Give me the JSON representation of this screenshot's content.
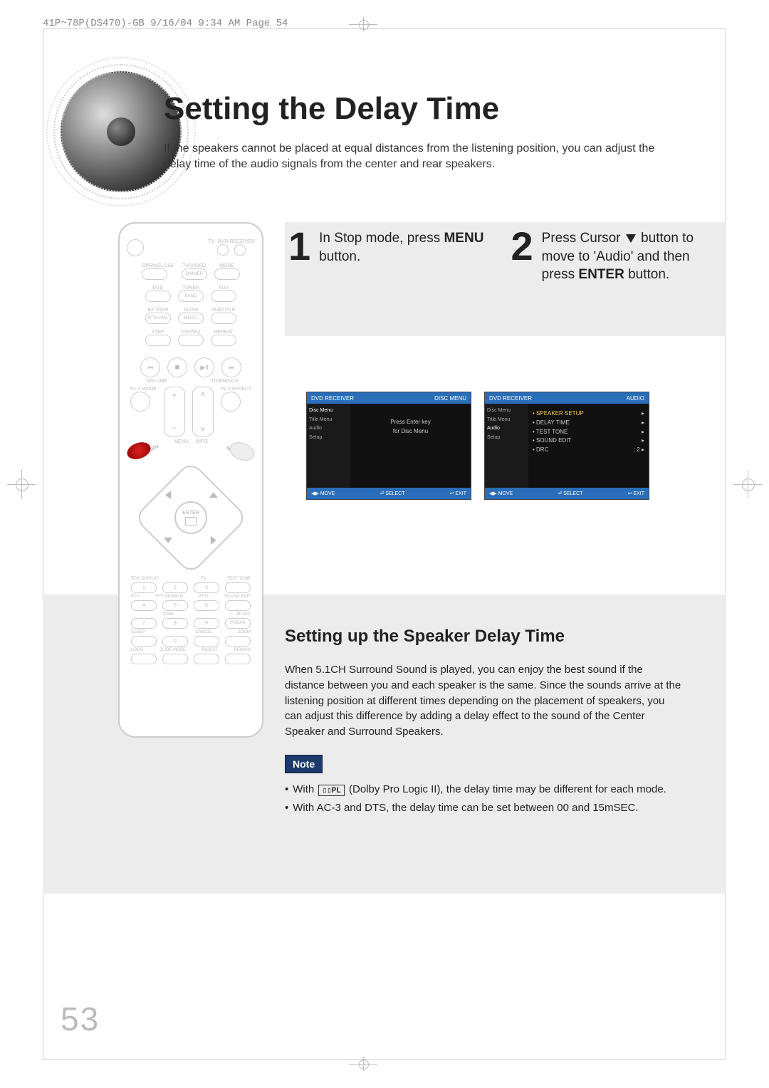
{
  "header_slug": "41P~78P(DS470)-GB  9/16/04 9:34 AM  Page 54",
  "title": "Setting the Delay Time",
  "intro": "If the speakers cannot be placed at equal distances from the listening position, you can adjust the delay time of the audio signals from the center and rear speakers.",
  "steps": [
    {
      "num": "1",
      "html": "In Stop mode, press <b>MENU</b> button."
    },
    {
      "num": "2",
      "html": "Press Cursor <span class='down-tri'></span> button to move to 'Audio' and then press <b>ENTER</b> button."
    }
  ],
  "osd1": {
    "top_left": "DVD RECEIVER",
    "top_right": "DISC MENU",
    "side_items": [
      "Disc Menu",
      "Title Menu",
      "Audio",
      "Setup"
    ],
    "main_lines": [
      "Press Enter key",
      "for Disc Menu"
    ],
    "btm_left": "MOVE",
    "btm_mid": "SELECT",
    "btm_right": "EXIT"
  },
  "osd2": {
    "top_left": "DVD RECEIVER",
    "top_right": "AUDIO",
    "side_items": [
      "Disc Menu",
      "Title Menu",
      "Audio",
      "Setup"
    ],
    "menu_items": [
      {
        "label": "SPEAKER SETUP",
        "value": ""
      },
      {
        "label": "DELAY TIME",
        "value": ""
      },
      {
        "label": "TEST TONE",
        "value": ""
      },
      {
        "label": "SOUND EDIT",
        "value": ""
      },
      {
        "label": "DRC",
        "value": ": 2"
      }
    ],
    "btm_left": "MOVE",
    "btm_mid": "SELECT",
    "btm_right": "EXIT"
  },
  "subheading": "Setting up the Speaker Delay Time",
  "sub_body": "When 5.1CH Surround Sound is played, you can enjoy the best sound if the distance between you and each speaker is the same. Since the sounds arrive at the listening position at different times depending on the placement of speakers, you can adjust this difference by adding a delay effect to the sound of the Center Speaker and Surround Speakers.",
  "note_label": "Note",
  "notes": [
    "With  PL  (Dolby Pro Logic II), the delay time may be different for each mode.",
    "With AC-3 and DTS, the delay time can be set between 00 and 15mSEC."
  ],
  "page_number": "53",
  "remote_labels": {
    "tv": "TV",
    "dvd": "DVD RECEIVER",
    "open_close": "OPEN/CLOSE",
    "tvvideo": "TV/VIDEO",
    "mode": "MODE",
    "dimmer": "DIMMER",
    "dvdl": "DVD",
    "tuner": "TUNER",
    "aux": "AUX",
    "band": "BAND",
    "ezview": "EZ VIEW",
    "slow": "SLOW",
    "subtitle": "SUBTITLE",
    "ntscpal": "NTSC/PAL",
    "most": "MO/ST",
    "step": "STEP",
    "dspeq": "DSP/EQ",
    "repeat": "REPEAT",
    "volume": "VOLUME",
    "tuningch": "TUNING/CH",
    "plmode": "PL II MODE",
    "pleff": "PL II EFFECT",
    "menu": "MENU",
    "info": "INFO",
    "return": "RETURN",
    "mute": "MUTE",
    "enter": "ENTER",
    "kp_r1": [
      "RDS DISPLAY",
      "TA",
      "TEST TONE"
    ],
    "kp_r2": [
      "PTY-",
      "PTY SEARCH",
      "PTY+",
      "SOUND EDIT"
    ],
    "kp_r3": [
      "",
      "TUNE",
      "",
      "MUSIC"
    ],
    "kp_r4": [
      "",
      "",
      "",
      "P.SCAN"
    ],
    "kp_r5": [
      "SLEEP",
      "",
      "CANCEL",
      "ZOOM"
    ],
    "kp_r6": [
      "LOGO",
      "SLIDE MODE",
      "DIGEST",
      "REMAIN"
    ]
  }
}
